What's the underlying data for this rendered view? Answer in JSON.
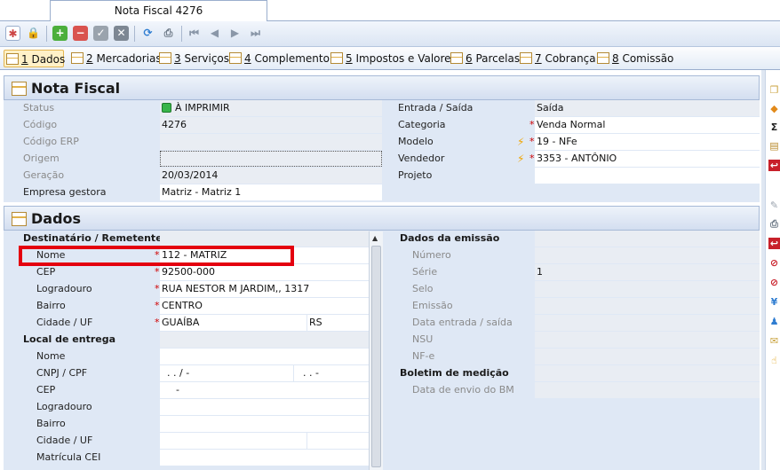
{
  "window": {
    "tab_title": "Nota Fiscal 4276"
  },
  "section_tabs": [
    {
      "num": "1",
      "label": " Dados"
    },
    {
      "num": "2",
      "label": " Mercadorias"
    },
    {
      "num": "3",
      "label": " Serviços"
    },
    {
      "num": "4",
      "label": " Complemento"
    },
    {
      "num": "5",
      "label": " Impostos e Valores"
    },
    {
      "num": "6",
      "label": " Parcelas"
    },
    {
      "num": "7",
      "label": " Cobrança"
    },
    {
      "num": "8",
      "label": " Comissão"
    }
  ],
  "nota_fiscal": {
    "title": "Nota Fiscal",
    "status_label": "Status",
    "status_value": "À IMPRIMIR",
    "codigo_label": "Código",
    "codigo_value": "4276",
    "codigo_erp_label": "Código ERP",
    "codigo_erp_value": "",
    "origem_label": "Origem",
    "origem_value": "",
    "geracao_label": "Geração",
    "geracao_value": "20/03/2014",
    "empresa_label": "Empresa gestora",
    "empresa_value": "Matriz - Matriz 1",
    "entrada_label": "Entrada / Saída",
    "entrada_value": "Saída",
    "categoria_label": "Categoria",
    "categoria_value": "Venda Normal",
    "modelo_label": "Modelo",
    "modelo_value": "19 - NFe",
    "vendedor_label": "Vendedor",
    "vendedor_value": "3353 - ANTÔNIO",
    "projeto_label": "Projeto",
    "projeto_value": ""
  },
  "dados": {
    "title": "Dados",
    "dest_header": "Destinatário / Remetente",
    "nome_label": "Nome",
    "nome_value": "112 - MATRIZ",
    "cep_label": "CEP",
    "cep_value": "92500-000",
    "logradouro_label": "Logradouro",
    "logradouro_value": "RUA NESTOR M JARDIM,, 1317",
    "bairro_label": "Bairro",
    "bairro_value": "CENTRO",
    "cidade_label": "Cidade / UF",
    "cidade_value": "GUAÍBA",
    "uf_value": "RS",
    "local_header": "Local de entrega",
    "le_nome_label": "Nome",
    "le_cnpj_label": "CNPJ / CPF",
    "le_cnpj_mask1": " .  .  /   -",
    "le_cnpj_mask2": ".  .  -",
    "le_cep_label": "CEP",
    "le_cep_mask": "-",
    "le_logradouro_label": "Logradouro",
    "le_bairro_label": "Bairro",
    "le_cidade_label": "Cidade / UF",
    "le_matricula_label": "Matrícula CEI",
    "emissao_header": "Dados da emissão",
    "numero_label": "Número",
    "numero_value": "",
    "serie_label": "Série",
    "serie_value": "1",
    "selo_label": "Selo",
    "emissao_label": "Emissão",
    "data_es_label": "Data entrada / saída",
    "nsu_label": "NSU",
    "nfe_label": "NF-e",
    "boletim_header": "Boletim de medição",
    "data_bm_label": "Data de envio do BM"
  },
  "colors": {
    "highlight": "#e4000f",
    "required": "#d00000",
    "accent": "#dfe8f5"
  }
}
